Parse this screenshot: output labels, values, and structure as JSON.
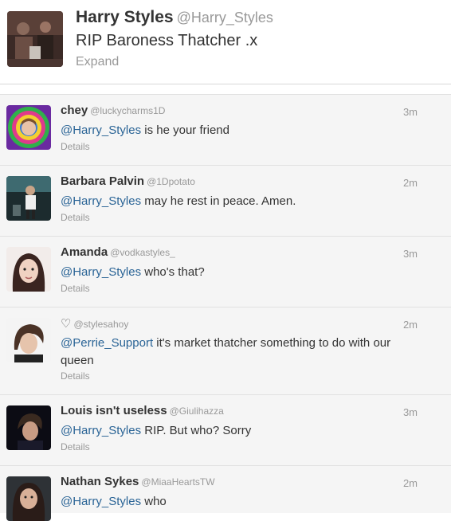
{
  "main_tweet": {
    "name": "Harry Styles",
    "handle": "@Harry_Styles",
    "text": "RIP Baroness Thatcher .x",
    "expand_label": "Expand"
  },
  "replies": [
    {
      "name": "chey",
      "handle": "@luckycharms1D",
      "time": "3m",
      "mention": "@Harry_Styles",
      "text": " is he your friend",
      "details": "Details"
    },
    {
      "name": "Barbara Palvin",
      "handle": "@1Dpotato",
      "time": "2m",
      "mention": "@Harry_Styles",
      "text": " may he rest in peace. Amen.",
      "details": "Details"
    },
    {
      "name": "Amanda",
      "handle": "@vodkastyles_",
      "time": "3m",
      "mention": "@Harry_Styles",
      "text": " who's that?",
      "details": "Details"
    },
    {
      "name": "♡",
      "handle": "@stylesahoy",
      "time": "2m",
      "mention": "@Perrie_Support",
      "text": " it's market thatcher something to do with our queen",
      "details": "Details"
    },
    {
      "name": "Louis isn't useless",
      "handle": "@Giulihazza",
      "time": "3m",
      "mention": "@Harry_Styles",
      "text": " RIP. But who? Sorry",
      "details": "Details"
    },
    {
      "name": "Nathan Sykes",
      "handle": "@MiaaHeartsTW",
      "time": "2m",
      "mention": "@Harry_Styles",
      "text": " who",
      "details": ""
    }
  ]
}
